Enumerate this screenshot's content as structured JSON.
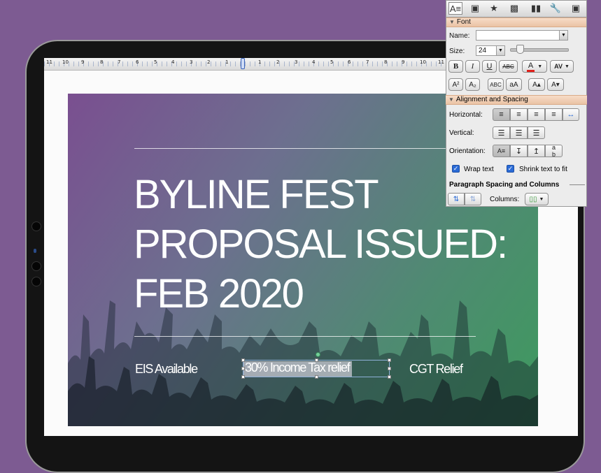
{
  "slide": {
    "title_lines": [
      "BYLINE FEST",
      "PROPOSAL ISSUED:",
      "FEB 2020"
    ],
    "sub_left": "EIS Available",
    "sub_center": "30% Income Tax relief",
    "sub_right": "CGT Relief"
  },
  "ruler": {
    "labels": [
      "11",
      "10",
      "9",
      "8",
      "7",
      "6",
      "5",
      "4",
      "3",
      "2",
      "1",
      "1",
      "2",
      "3",
      "4",
      "5",
      "6",
      "7",
      "8",
      "9",
      "10",
      "11"
    ]
  },
  "palette": {
    "tabs": [
      "text-box-icon",
      "insert-picture-icon",
      "star-shapes-icon",
      "image-frame-icon",
      "library-icon",
      "wrench-icon",
      "toolbox-icon"
    ],
    "font_section": "Font",
    "name_label": "Name:",
    "name_value": "",
    "size_label": "Size:",
    "size_value": "24",
    "btn_bold": "B",
    "btn_italic": "I",
    "btn_underline": "U",
    "btn_strike": "ABC",
    "btn_color": "A",
    "btn_spacing": "AV",
    "btn_super": "A²",
    "btn_sub": "A₂",
    "btn_smallcaps": "ABC",
    "btn_changecase": "aA",
    "btn_grow": "A▴",
    "btn_shrink": "A▾",
    "align_section": "Alignment and Spacing",
    "horizontal_label": "Horizontal:",
    "vertical_label": "Vertical:",
    "orientation_label": "Orientation:",
    "wrap_text": "Wrap text",
    "shrink_text": "Shrink text to fit",
    "para_section": "Paragraph Spacing and Columns",
    "columns_label": "Columns:",
    "colors": {
      "font_color_bar": "#e0211b",
      "checkbox": "#2b6bd6"
    }
  }
}
